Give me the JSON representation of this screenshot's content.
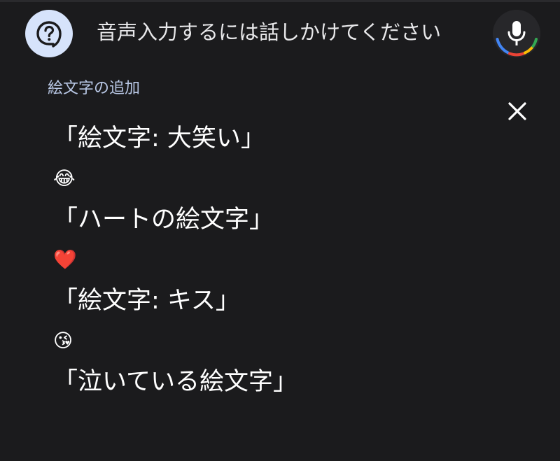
{
  "header": {
    "hint": "音声入力するには話しかけてください",
    "help_icon": "help-bubble-icon",
    "mic_icon": "microphone-icon"
  },
  "panel": {
    "title": "絵文字の追加",
    "close_icon": "close-icon",
    "items": [
      {
        "phrase": "「絵文字: 大笑い」",
        "emoji": "😂"
      },
      {
        "phrase": "「ハートの絵文字」",
        "emoji": "❤️"
      },
      {
        "phrase": "「絵文字: キス」",
        "emoji": "😘"
      },
      {
        "phrase": "「泣いている絵文字」"
      }
    ]
  },
  "colors": {
    "background": "#1b1b1d",
    "help_button_bg": "#d6e3fb",
    "section_title": "#b9c8e6",
    "mic_ring": [
      "#4285f4",
      "#ea4335",
      "#fbbc05",
      "#34a853"
    ]
  }
}
